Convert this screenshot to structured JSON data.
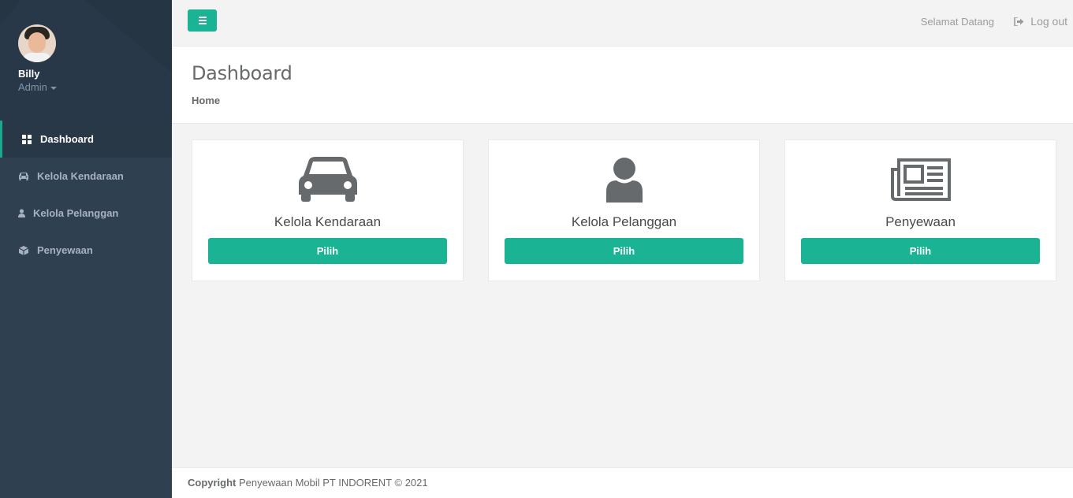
{
  "user": {
    "name": "Billy",
    "role": "Admin"
  },
  "sidebar": {
    "items": [
      {
        "label": "Dashboard",
        "icon": "dashboard-icon",
        "active": true
      },
      {
        "label": "Kelola Kendaraan",
        "icon": "car-icon",
        "active": false
      },
      {
        "label": "Kelola Pelanggan",
        "icon": "user-icon",
        "active": false
      },
      {
        "label": "Penyewaan",
        "icon": "cube-icon",
        "active": false
      }
    ]
  },
  "topbar": {
    "welcome": "Selamat Datang",
    "logout": "Log out"
  },
  "page": {
    "title": "Dashboard",
    "breadcrumb": "Home"
  },
  "cards": [
    {
      "title": "Kelola Kendaraan",
      "icon": "car-icon",
      "button": "Pilih"
    },
    {
      "title": "Kelola Pelanggan",
      "icon": "user-icon",
      "button": "Pilih"
    },
    {
      "title": "Penyewaan",
      "icon": "newspaper-icon",
      "button": "Pilih"
    }
  ],
  "footer": {
    "copyright_label": "Copyright",
    "text": "Penyewaan Mobil PT INDORENT © 2021"
  },
  "colors": {
    "accent": "#1ab394",
    "sidebar": "#2f4050",
    "icon_gray": "#676a6c"
  }
}
